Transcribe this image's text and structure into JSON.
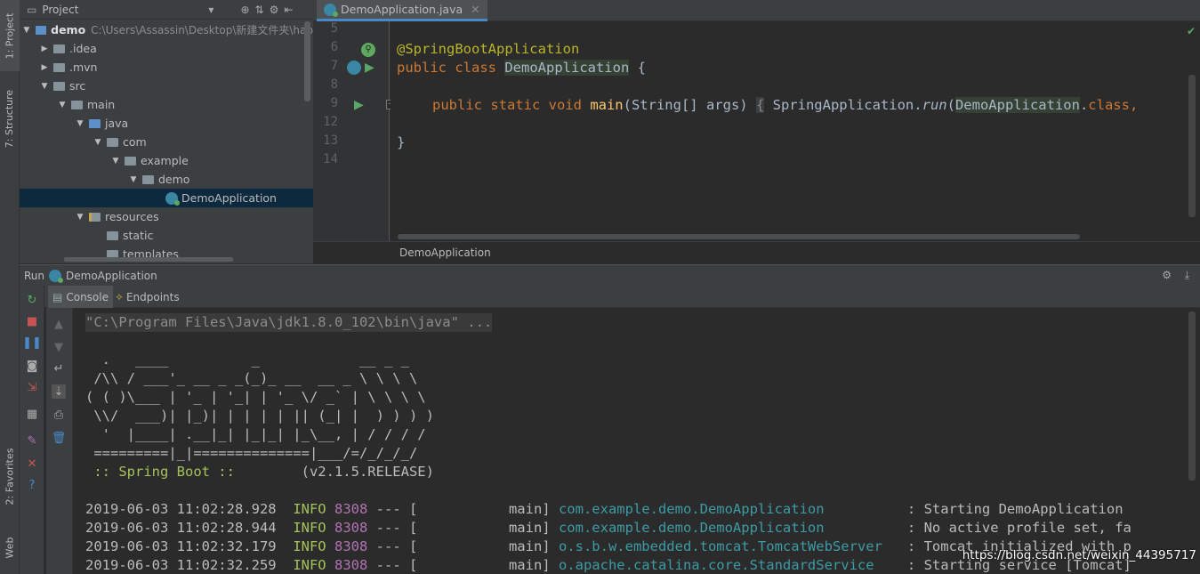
{
  "side_tabs": {
    "project": "1: Project",
    "structure": "7: Structure",
    "favorites": "2: Favorites",
    "web": "Web"
  },
  "project": {
    "title": "Project",
    "tree": [
      {
        "label": "demo",
        "path": "C:\\Users\\Assassin\\Desktop\\新建文件夹\\hap"
      },
      {
        "label": ".idea"
      },
      {
        "label": ".mvn"
      },
      {
        "label": "src"
      },
      {
        "label": "main"
      },
      {
        "label": "java"
      },
      {
        "label": "com"
      },
      {
        "label": "example"
      },
      {
        "label": "demo"
      },
      {
        "label": "DemoApplication"
      },
      {
        "label": "resources"
      },
      {
        "label": "static"
      },
      {
        "label": "templates"
      }
    ]
  },
  "editor": {
    "tab": "DemoApplication.java",
    "line_numbers": [
      "5",
      "6",
      "7",
      "8",
      "9",
      "12",
      "13",
      "14"
    ],
    "code": {
      "annotation": "@SpringBootApplication",
      "l7_kw": "public class ",
      "l7_cls": "DemoApplication",
      "l7_end": " {",
      "l9_kw": "public static void ",
      "l9_fn": "main",
      "l9_args": "(String[] args) ",
      "l9_fold": "{",
      "l9_call": " SpringApplication.",
      "l9_run": "run",
      "l9_paren": "(",
      "l9_cls": "DemoApplication",
      "l9_dot": ".",
      "l9_class_kw": "class,",
      "l13": "}"
    },
    "breadcrumb": "DemoApplication"
  },
  "run": {
    "label": "Run",
    "config": "DemoApplication",
    "tabs": [
      "Console",
      "Endpoints"
    ]
  },
  "console": {
    "cmd": "\"C:\\Program Files\\Java\\jdk1.8.0_102\\bin\\java\" ...",
    "banner": [
      "  .   ____          _            __ _ _",
      " /\\\\ / ___'_ __ _ _(_)_ __  __ _ \\ \\ \\ \\",
      "( ( )\\___ | '_ | '_| | '_ \\/ _` | \\ \\ \\ \\",
      " \\\\/  ___)| |_)| | | | | || (_| |  ) ) ) )",
      "  '  |____| .__|_| |_|_| |_\\__, | / / / /",
      " =========|_|==============|___/=/_/_/_/"
    ],
    "spring_label": " :: Spring Boot :: ",
    "version": "       (v2.1.5.RELEASE)",
    "logs": [
      {
        "ts": "2019-06-03 11:02:28.928",
        "level": "INFO",
        "pid": "8308",
        "sep": "--- [           main]",
        "cls": "com.example.demo.DemoApplication        ",
        "msg": "  : Starting DemoApplication"
      },
      {
        "ts": "2019-06-03 11:02:28.944",
        "level": "INFO",
        "pid": "8308",
        "sep": "--- [           main]",
        "cls": "com.example.demo.DemoApplication        ",
        "msg": "  : No active profile set, fa"
      },
      {
        "ts": "2019-06-03 11:02:32.179",
        "level": "INFO",
        "pid": "8308",
        "sep": "--- [           main]",
        "cls": "o.s.b.w.embedded.tomcat.TomcatWebServer ",
        "msg": "  : Tomcat initialized with p"
      },
      {
        "ts": "2019-06-03 11:02:32.259",
        "level": "INFO",
        "pid": "8308",
        "sep": "--- [           main]",
        "cls": "o.apache.catalina.core.StandardService  ",
        "msg": "  : Starting service [Tomcat]"
      }
    ]
  },
  "watermark": "https://blog.csdn.net/weixin_44395717",
  "colors": {
    "accent": "#4a88c7",
    "keyword": "#cc7832",
    "annotation": "#bbb529",
    "function": "#ffc66d",
    "console_class": "#3d9ba6",
    "info": "#a5c25c",
    "pid": "#b173b4"
  }
}
